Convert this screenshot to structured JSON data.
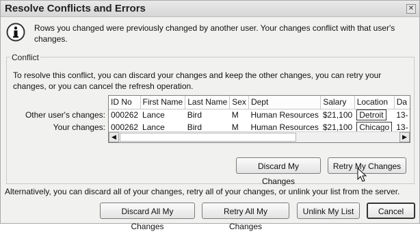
{
  "dialog": {
    "title": "Resolve Conflicts and Errors",
    "close_glyph": "✕",
    "message": "Rows you changed were previously changed by another user. Your changes conflict with that user's changes."
  },
  "conflict": {
    "legend": "Conflict",
    "instructions": "To resolve this conflict, you can discard your changes and keep the other changes, you can retry your changes, or you can cancel the refresh operation.",
    "other_label": "Other user's changes:",
    "your_label": "Your changes:",
    "columns": [
      "ID No",
      "First Name",
      "Last Name",
      "Sex",
      "Dept",
      "Salary",
      "Location",
      "Da"
    ],
    "rows": [
      [
        "000262",
        "Lance",
        "Bird",
        "M",
        "Human Resources",
        "$21,100",
        "Detroit",
        "13-"
      ],
      [
        "000262",
        "Lance",
        "Bird",
        "M",
        "Human Resources",
        "$21,100",
        "Chicago",
        "13-"
      ]
    ],
    "scroll_left": "◀",
    "scroll_right": "▶",
    "discard_label": "Discard My Changes",
    "retry_label": "Retry My Changes"
  },
  "footer": {
    "alternatively": "Alternatively, you can discard all of your changes, retry all of your changes, or unlink your list from the server.",
    "discard_all_label": "Discard All My Changes",
    "retry_all_label": "Retry All My Changes",
    "unlink_label": "Unlink My List",
    "cancel_label": "Cancel"
  },
  "icons": {
    "info": "info-icon",
    "cursor": "mouse-pointer-icon"
  }
}
